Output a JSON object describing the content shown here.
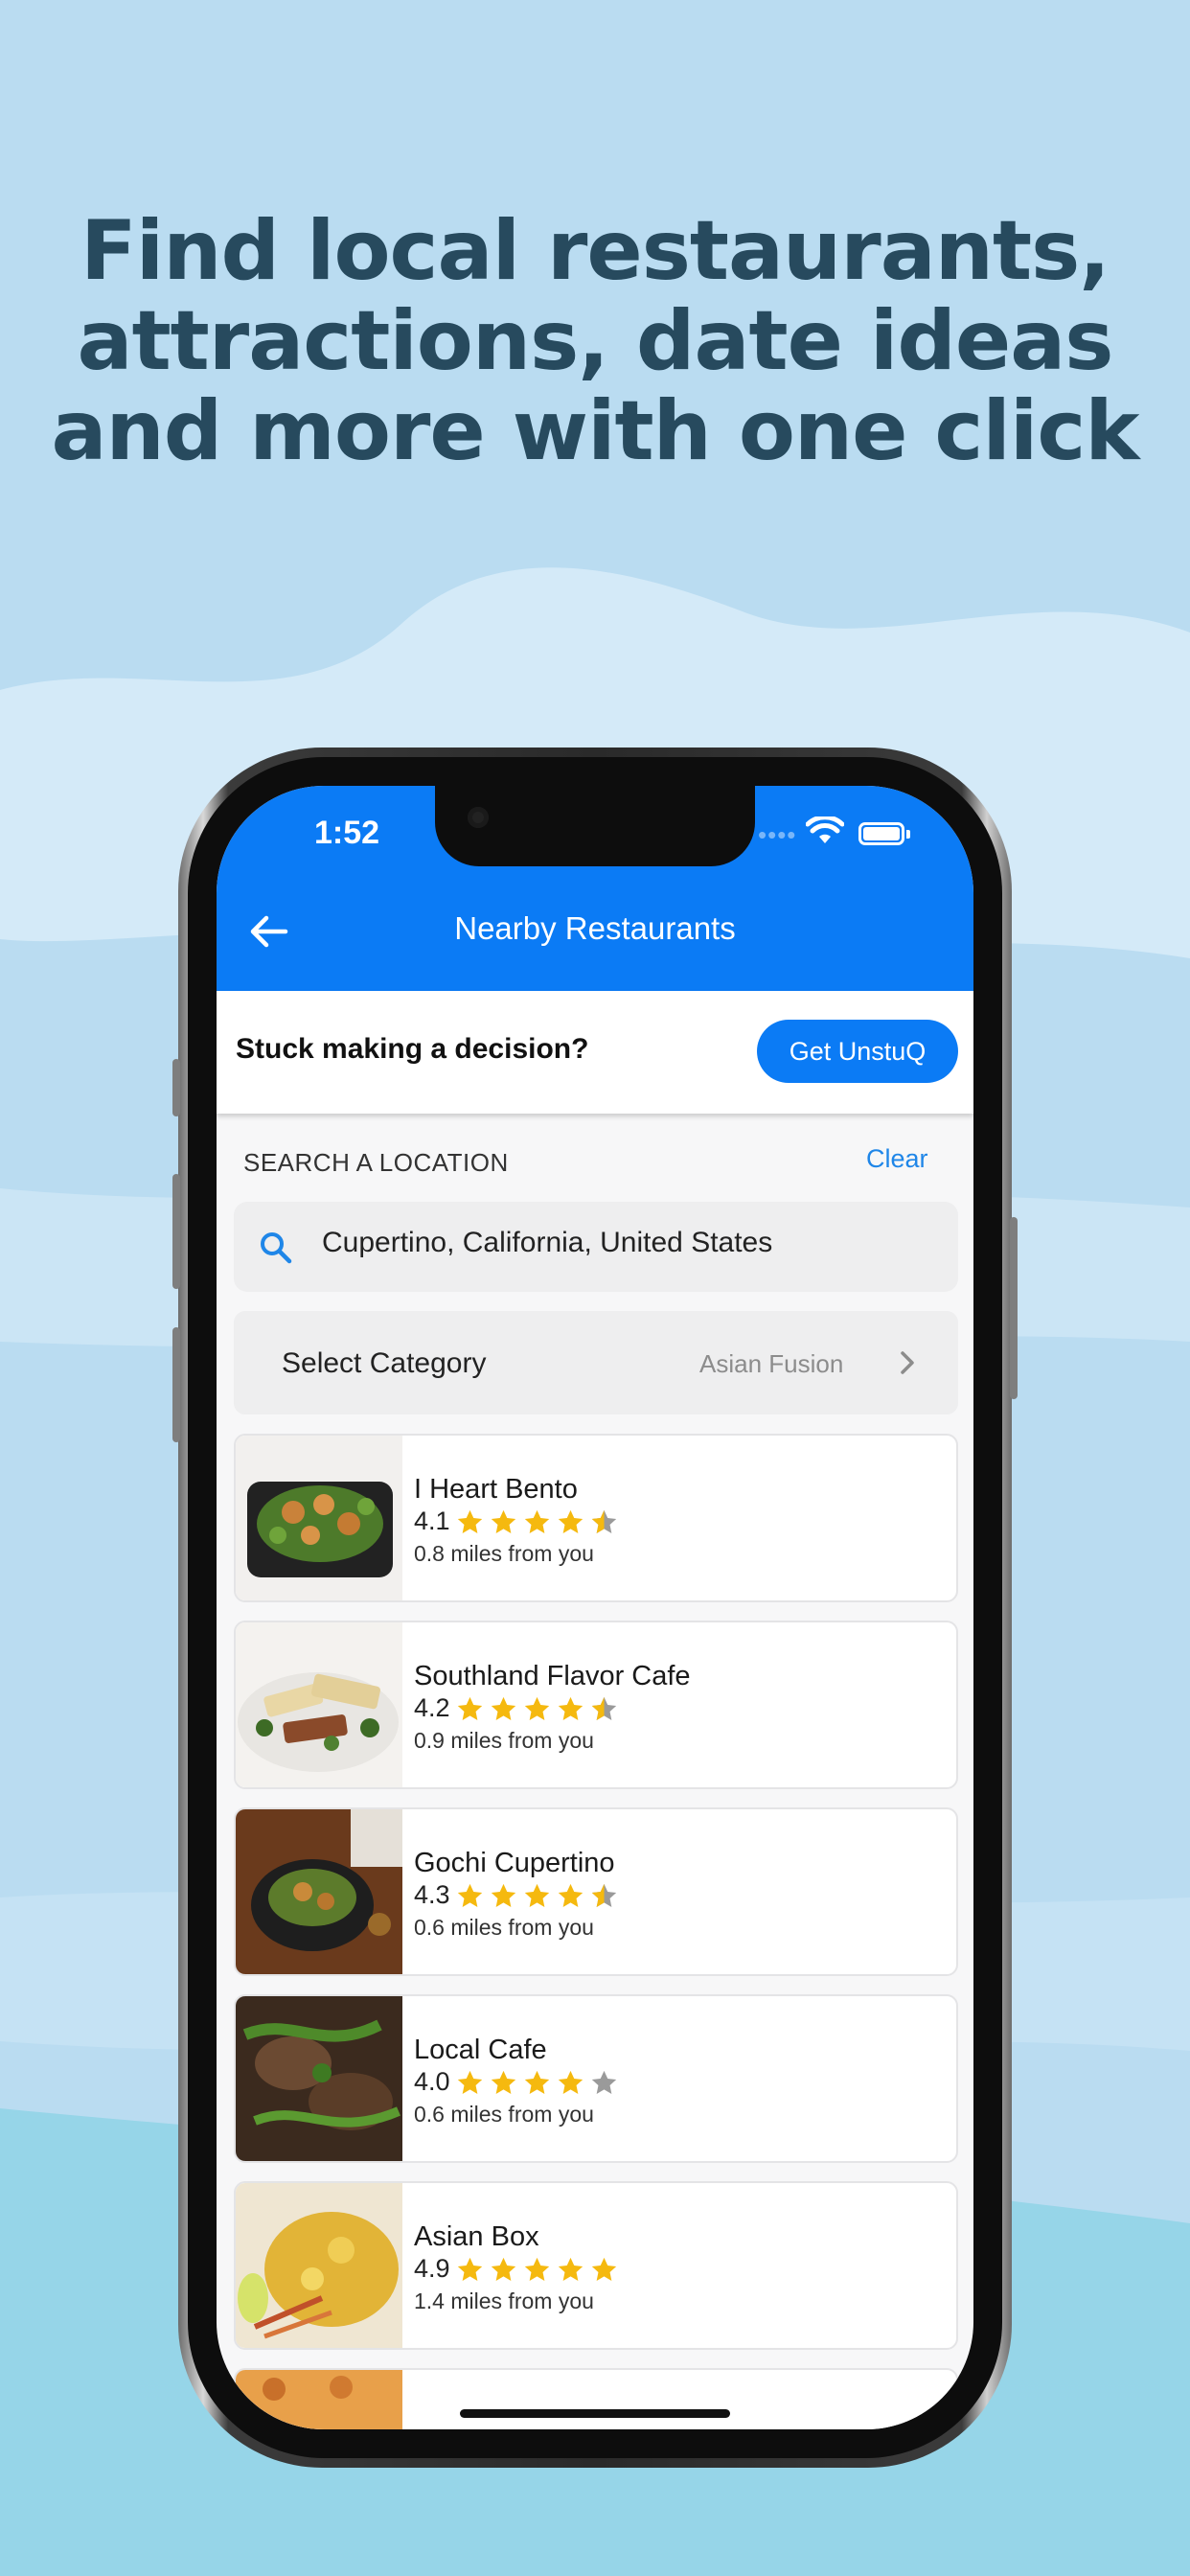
{
  "headline": {
    "line1": "Find local restaurants,",
    "line2": "attractions, date ideas",
    "line3": "and more with one click"
  },
  "status_bar": {
    "time": "1:52",
    "signal_dots": "••••",
    "icons": [
      "wifi-icon",
      "battery-icon"
    ]
  },
  "nav": {
    "title": "Nearby Restaurants",
    "back_icon": "arrow-left-icon"
  },
  "decision_bar": {
    "prompt": "Stuck making a decision?",
    "button_label": "Get UnstuQ"
  },
  "search": {
    "section_label": "SEARCH A LOCATION",
    "clear_label": "Clear",
    "location_value": "Cupertino, California, United States"
  },
  "category": {
    "label": "Select Category",
    "value": "Asian Fusion"
  },
  "restaurants": [
    {
      "name": "I Heart Bento",
      "rating": "4.1",
      "stars": 4.5,
      "distance": "0.8 miles from you"
    },
    {
      "name": "Southland Flavor Cafe",
      "rating": "4.2",
      "stars": 4.5,
      "distance": "0.9 miles from you"
    },
    {
      "name": "Gochi Cupertino",
      "rating": "4.3",
      "stars": 4.5,
      "distance": "0.6 miles from you"
    },
    {
      "name": "Local Cafe",
      "rating": "4.0",
      "stars": 4,
      "distance": "0.6 miles from you"
    },
    {
      "name": "Asian Box",
      "rating": "4.9",
      "stars": 5,
      "distance": "1.4 miles from you"
    }
  ],
  "colors": {
    "brand_blue": "#0b7bf5",
    "star_gold": "#f5b90f",
    "star_gray": "#9a9a9a",
    "headline": "#274a5e"
  }
}
